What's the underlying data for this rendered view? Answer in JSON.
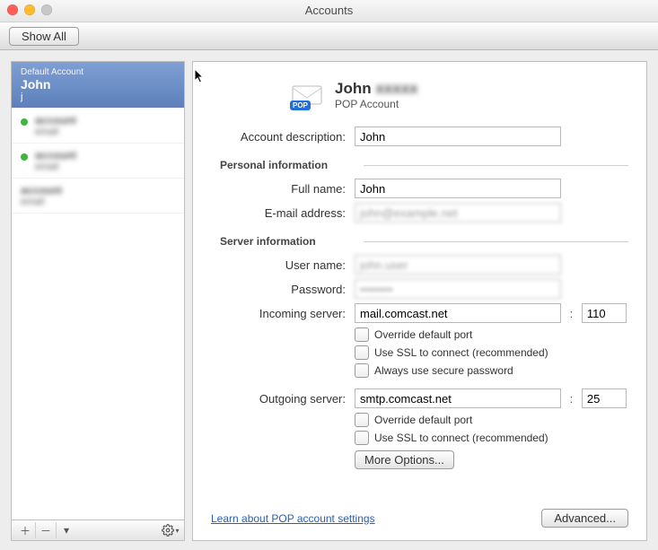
{
  "window": {
    "title": "Accounts"
  },
  "toolbar": {
    "show_all": "Show All"
  },
  "sidebar": {
    "default_label": "Default Account",
    "selected": {
      "name": "John",
      "email": "j"
    },
    "items": [
      {
        "name": "account",
        "email": "email"
      },
      {
        "name": "account",
        "email": "email"
      },
      {
        "name": "account",
        "email": "email"
      }
    ]
  },
  "header": {
    "name": "John",
    "type": "POP Account",
    "pop_badge": "POP"
  },
  "labels": {
    "description": "Account description:",
    "personal": "Personal information",
    "fullname": "Full name:",
    "email": "E-mail address:",
    "server": "Server information",
    "username": "User name:",
    "password": "Password:",
    "incoming": "Incoming server:",
    "outgoing": "Outgoing server:"
  },
  "values": {
    "description": "John",
    "fullname": "John",
    "email": "john@example.net",
    "username": "john.user",
    "password": "••••••••",
    "incoming_server": "mail.comcast.net",
    "incoming_port": "110",
    "outgoing_server": "smtp.comcast.net",
    "outgoing_port": "25"
  },
  "checks": {
    "override_port": "Override default port",
    "use_ssl": "Use SSL to connect (recommended)",
    "secure_pw": "Always use secure password"
  },
  "buttons": {
    "more_options": "More Options...",
    "advanced": "Advanced...",
    "learn": "Learn about POP account settings"
  }
}
